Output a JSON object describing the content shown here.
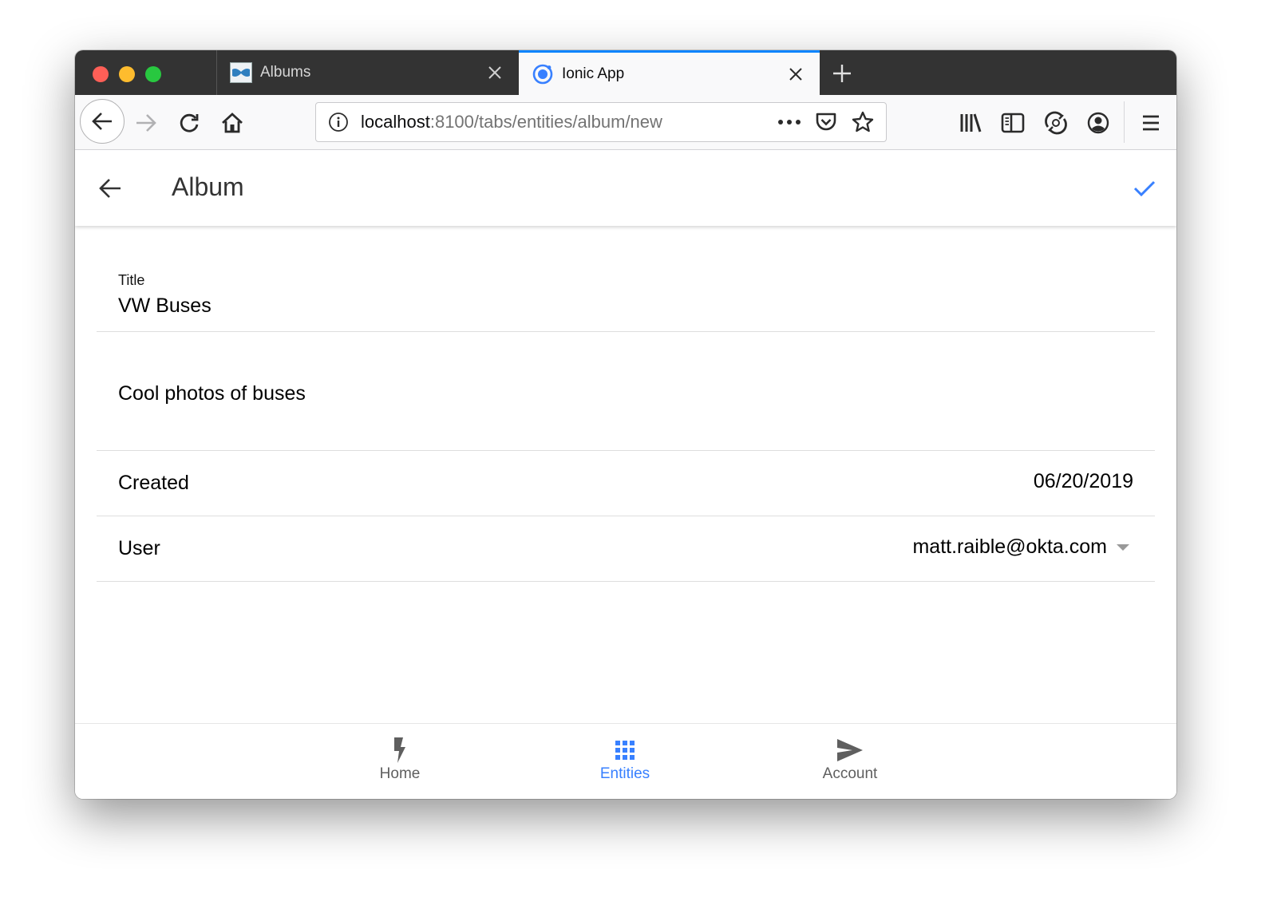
{
  "browser": {
    "tabs": [
      {
        "title": "Albums",
        "favicon": "bowtie-icon",
        "active": false
      },
      {
        "title": "Ionic App",
        "favicon": "ionic-icon",
        "active": true
      }
    ],
    "url": {
      "host": "localhost",
      "path": ":8100/tabs/entities/album/new"
    },
    "colors": {
      "active_tab_accent": "#0a84ff"
    }
  },
  "header": {
    "title": "Album",
    "accent": "#3880ff"
  },
  "form": {
    "title_label": "Title",
    "title_value": "VW Buses",
    "description_value": "Cool photos of buses",
    "created_label": "Created",
    "created_value": "06/20/2019",
    "user_label": "User",
    "user_value": "matt.raible@okta.com"
  },
  "tabbar": {
    "items": [
      {
        "label": "Home",
        "icon": "flash-icon",
        "selected": false
      },
      {
        "label": "Entities",
        "icon": "apps-grid-icon",
        "selected": true
      },
      {
        "label": "Account",
        "icon": "send-icon",
        "selected": false
      }
    ]
  }
}
